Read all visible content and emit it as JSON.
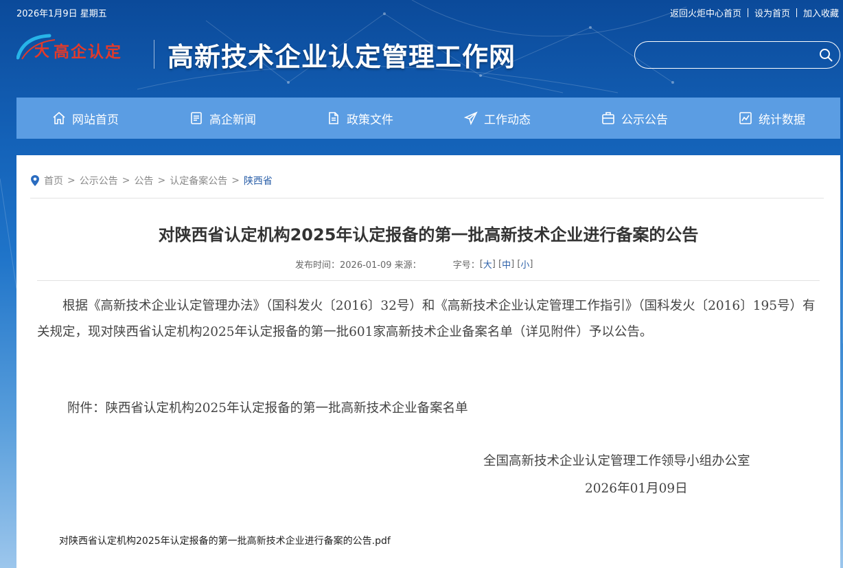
{
  "topbar": {
    "date": "2026年1月9日 星期五",
    "links": [
      "返回火炬中心首页",
      "设为首页",
      "加入收藏"
    ]
  },
  "header": {
    "logo_text": "高企认定",
    "site_title": "高新技术企业认定管理工作网",
    "search_placeholder": ""
  },
  "nav": {
    "items": [
      {
        "label": "网站首页",
        "icon": "home-icon"
      },
      {
        "label": "高企新闻",
        "icon": "news-icon"
      },
      {
        "label": "政策文件",
        "icon": "document-icon"
      },
      {
        "label": "工作动态",
        "icon": "send-icon"
      },
      {
        "label": "公示公告",
        "icon": "announcement-icon"
      },
      {
        "label": "统计数据",
        "icon": "chart-icon"
      }
    ]
  },
  "breadcrumb": {
    "items": [
      "首页",
      "公示公告",
      "公告",
      "认定备案公告",
      "陕西省"
    ]
  },
  "article": {
    "title": "对陕西省认定机构2025年认定报备的第一批高新技术企业进行备案的公告",
    "meta_date_label": "发布时间：2026-01-09 来源：",
    "font_size_label": "字号：",
    "font_sizes": [
      "大",
      "中",
      "小"
    ],
    "paragraph": "根据《高新技术企业认定管理办法》（国科发火〔2016〕32号）和《高新技术企业认定管理工作指引》（国科发火〔2016〕195号）有关规定，现对陕西省认定机构2025年认定报备的第一批601家高新技术企业备案名单（详见附件）予以公告。",
    "attachment_line": "附件：陕西省认定机构2025年认定报备的第一批高新技术企业备案名单",
    "signature_org": "全国高新技术企业认定管理工作领导小组办公室",
    "signature_date": "2026年01月09日",
    "pdf_link": "对陕西省认定机构2025年认定报备的第一批高新技术企业进行备案的公告.pdf"
  },
  "colors": {
    "nav_bg": "#5b9de3",
    "logo_red": "#e23a2a",
    "link_blue": "#2a5fa8"
  }
}
